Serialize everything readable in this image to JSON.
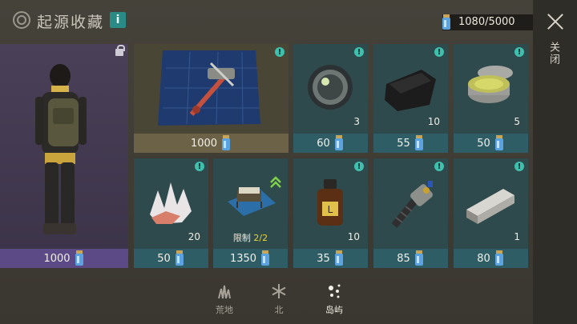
{
  "header": {
    "title": "起源收藏",
    "info_label": "i",
    "currency": "1080/5000",
    "close_label": "关闭"
  },
  "character": {
    "price": "1000"
  },
  "items": [
    {
      "id": "blueprint",
      "price": "1000",
      "qty": "",
      "icon": "crossbow-blueprint-icon"
    },
    {
      "id": "lens",
      "price": "60",
      "qty": "3",
      "icon": "lens-icon"
    },
    {
      "id": "cloth",
      "price": "55",
      "qty": "10",
      "icon": "black-cloth-icon"
    },
    {
      "id": "jar",
      "price": "50",
      "qty": "5",
      "icon": "jar-icon"
    },
    {
      "id": "crystal",
      "price": "50",
      "qty": "20",
      "icon": "crystal-icon"
    },
    {
      "id": "bed",
      "price": "1350",
      "qty": "",
      "icon": "bed-blueprint-icon",
      "limit_label": "限制",
      "limit_value": "2/2"
    },
    {
      "id": "bottle",
      "price": "35",
      "qty": "10",
      "icon": "bottle-icon"
    },
    {
      "id": "drill",
      "price": "85",
      "qty": "",
      "icon": "drill-icon"
    },
    {
      "id": "ingot",
      "price": "80",
      "qty": "1",
      "icon": "metal-ingot-icon"
    }
  ],
  "tabs": [
    {
      "label": "荒地",
      "icon": "grass-icon",
      "active": false
    },
    {
      "label": "北",
      "icon": "snowflake-icon",
      "active": false
    },
    {
      "label": "岛屿",
      "icon": "sparkle-icon",
      "active": true
    }
  ],
  "colors": {
    "character_bar": "#5c4a86",
    "item_bar": "#2f5d66",
    "alert": "#3fbfae",
    "limit_highlight": "#e7d43a"
  }
}
